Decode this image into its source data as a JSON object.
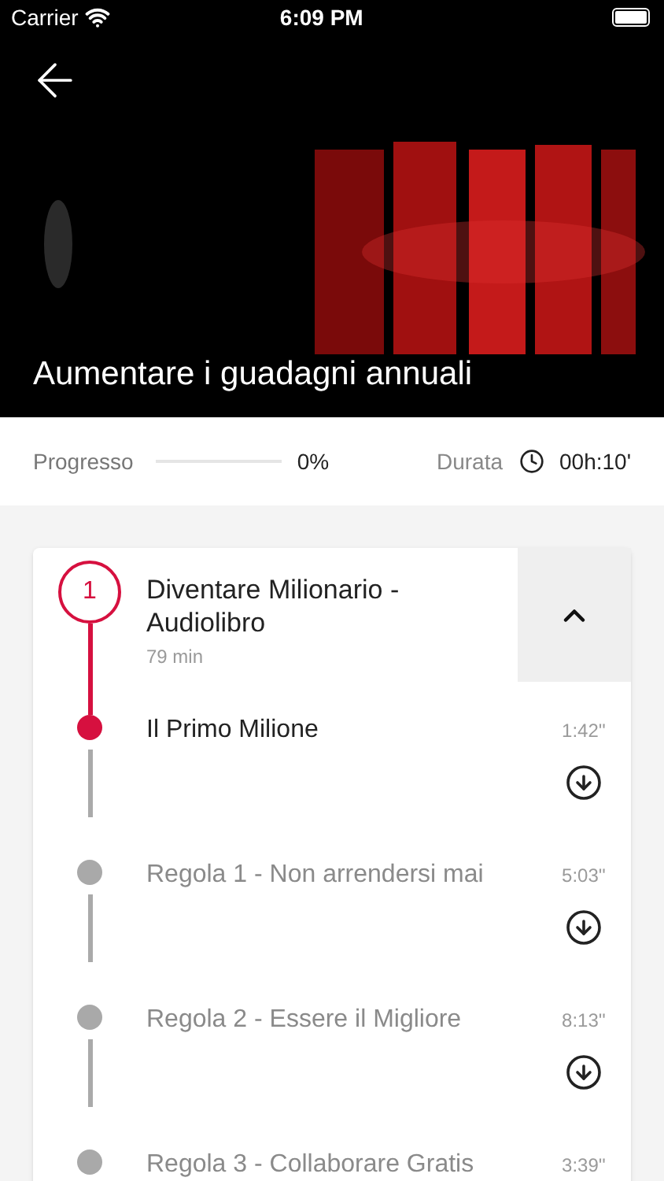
{
  "status_bar": {
    "carrier": "Carrier",
    "time": "6:09 PM"
  },
  "hero": {
    "kind": "picture",
    "title": "Aumentare i guadagni annuali"
  },
  "progress": {
    "label": "Progresso",
    "level": 0,
    "value": "0%",
    "duration_label": "Durata",
    "duration": "00h:10'"
  },
  "section": {
    "number": "1",
    "title": "Diventare Milionario - Audiolibro",
    "subtitle": "79 min",
    "expanded": true,
    "lessons": [
      {
        "title": "Il Primo Milione",
        "time": "1:42''",
        "active": true
      },
      {
        "title": "Regola 1 - Non arrendersi mai",
        "time": "5:03''",
        "active": false
      },
      {
        "title": "Regola 2 - Essere il Migliore",
        "time": "8:13''",
        "active": false
      },
      {
        "title": "Regola 3 - Collaborare Gratis",
        "time": "3:39''",
        "active": false
      }
    ]
  }
}
